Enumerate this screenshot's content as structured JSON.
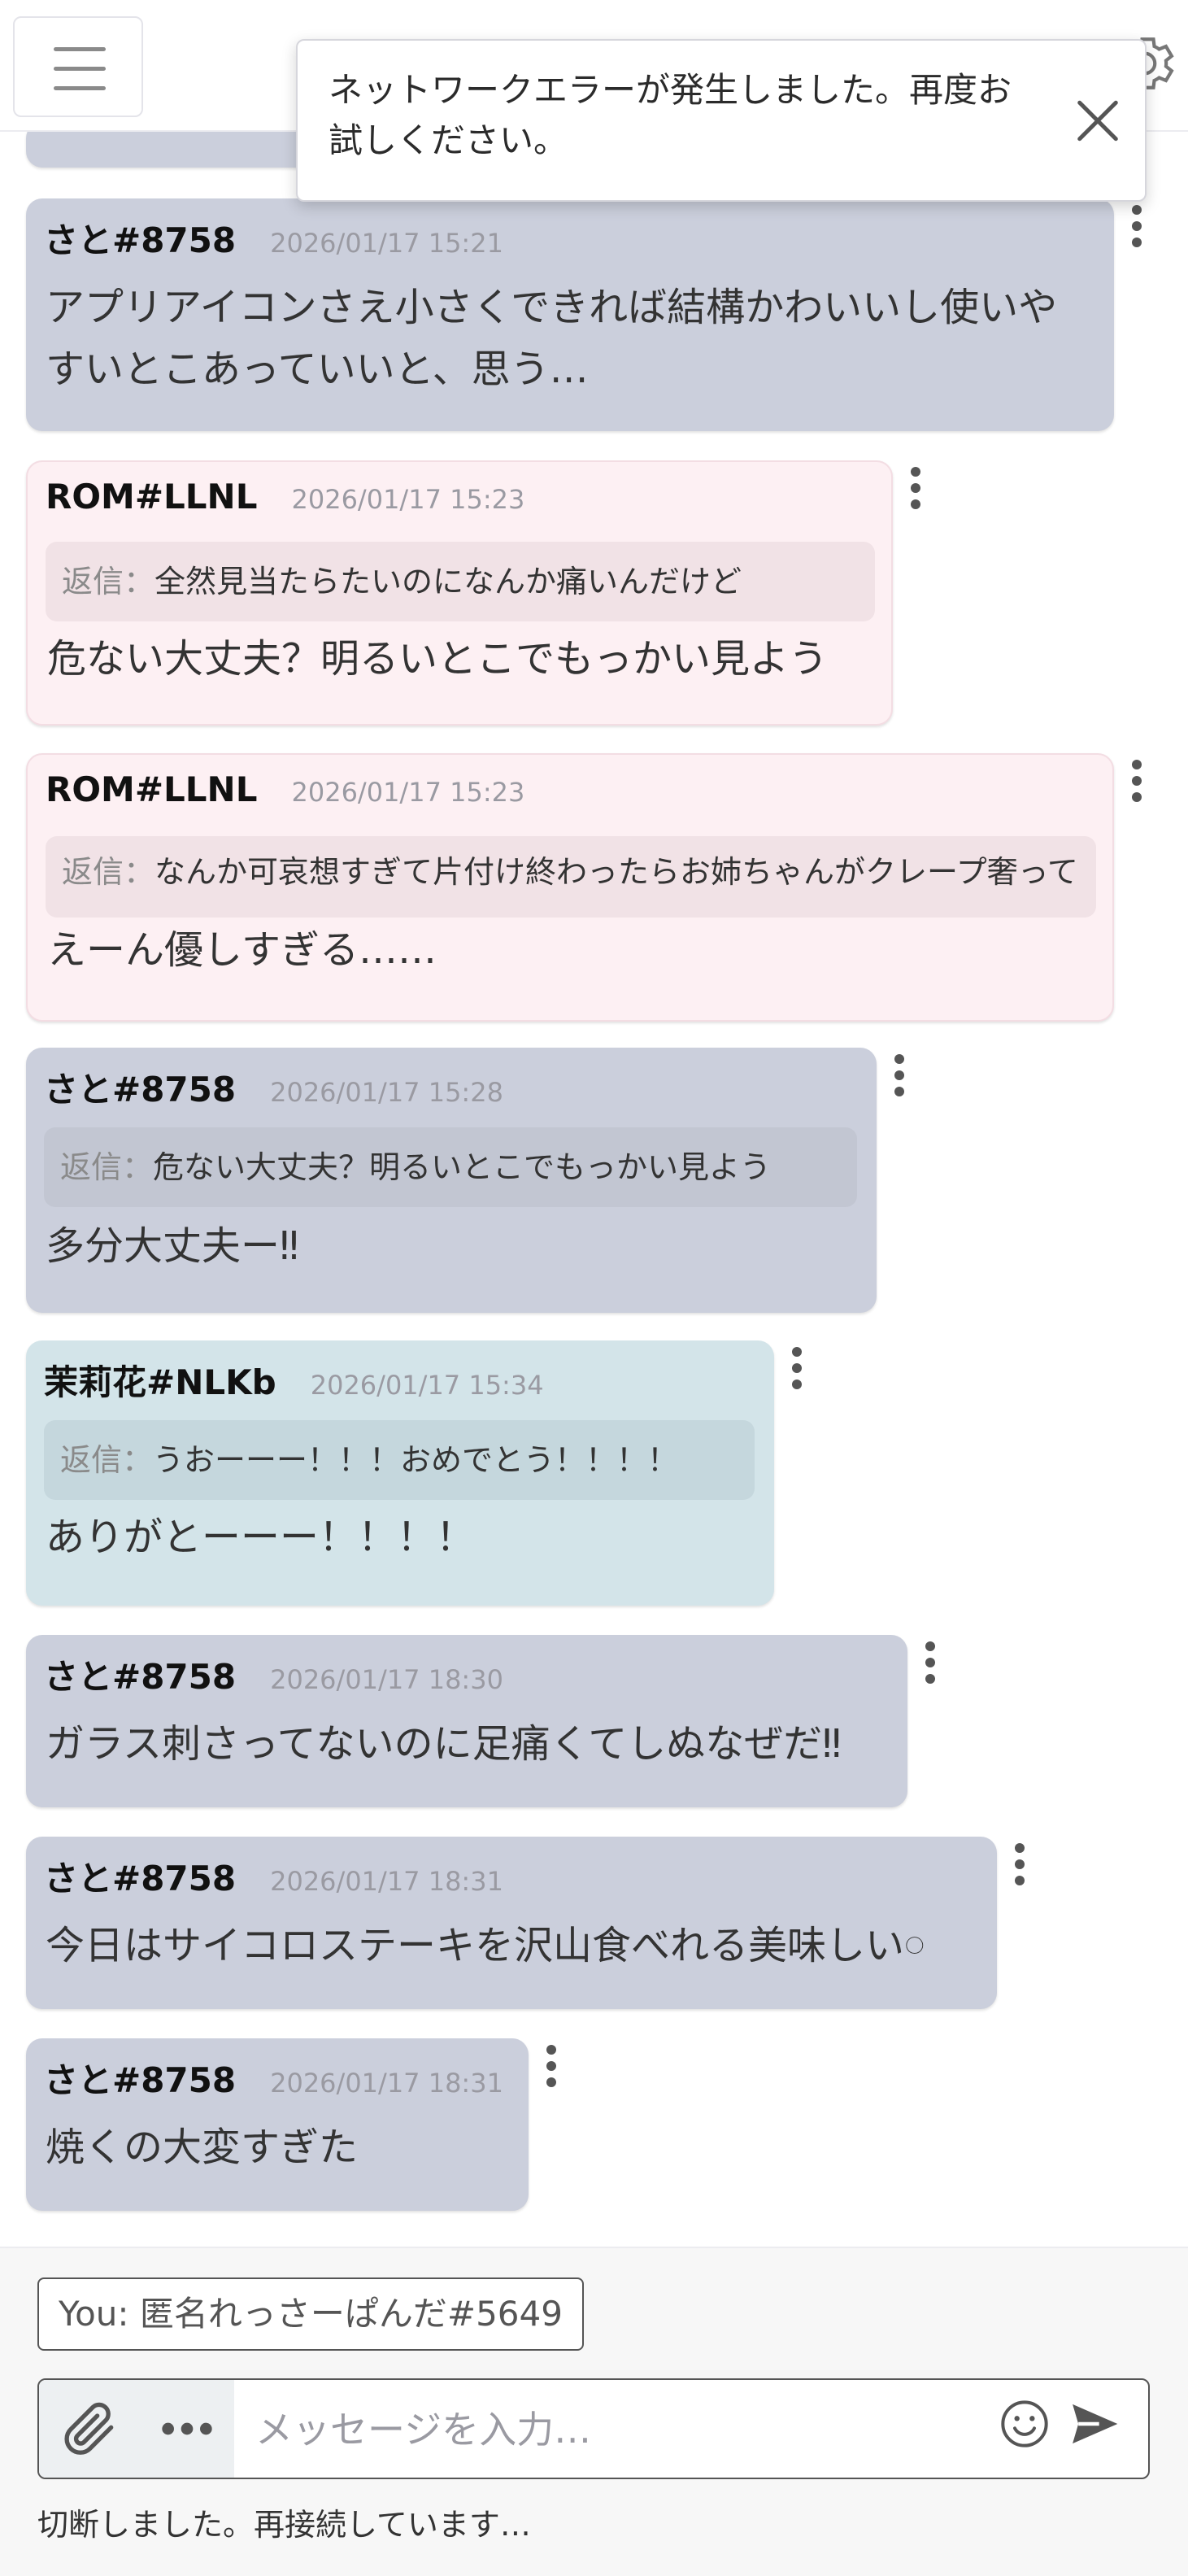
{
  "toast": {
    "message": "ネットワークエラーが発生しました。再度お試しください。"
  },
  "messages": [
    {
      "author": "さと#8758",
      "time": "2026/01/17 15:21",
      "reply_label": "",
      "reply": "",
      "body": "アプリアイコンさえ小さくできれば結構かわいいし使いやすいとこあっていいと、思う…"
    },
    {
      "author": "ROM#LLNL",
      "time": "2026/01/17 15:23",
      "reply_label": "返信：",
      "reply": "全然見当たらたいのになんか痛いんだけど",
      "body": "危ない大丈夫？明るいとこでもっかい見よう"
    },
    {
      "author": "ROM#LLNL",
      "time": "2026/01/17 15:23",
      "reply_label": "返信：",
      "reply": "なんか可哀想すぎて片付け終わったらお姉ちゃんがクレープ奢ってあげるよ♡とか言ってしまったよ……スイーツ屋さん行",
      "body": "えーん優しすぎる……"
    },
    {
      "author": "さと#8758",
      "time": "2026/01/17 15:28",
      "reply_label": "返信：",
      "reply": "危ない大丈夫？明るいとこでもっかい見よう",
      "body": "多分大丈夫ー‼"
    },
    {
      "author": "茉莉花#NLKb",
      "time": "2026/01/17 15:34",
      "reply_label": "返信：",
      "reply": "うおーーー！！！おめでとう！！！！",
      "body": "ありがとーーー！！！！"
    },
    {
      "author": "さと#8758",
      "time": "2026/01/17 18:30",
      "reply_label": "",
      "reply": "",
      "body": "ガラス刺さってないのに足痛くてしぬなぜだ‼"
    },
    {
      "author": "さと#8758",
      "time": "2026/01/17 18:31",
      "reply_label": "",
      "reply": "",
      "body": "今日はサイコロステーキを沢山食べれる美味しい𓏸"
    },
    {
      "author": "さと#8758",
      "time": "2026/01/17 18:31",
      "reply_label": "",
      "reply": "",
      "body": "焼くの大変すぎた"
    }
  ],
  "composer": {
    "you_label": "You: 匿名れっさーぱんだ#5649",
    "placeholder": "メッセージを入力…",
    "status": "切断しました。再接続しています…"
  }
}
